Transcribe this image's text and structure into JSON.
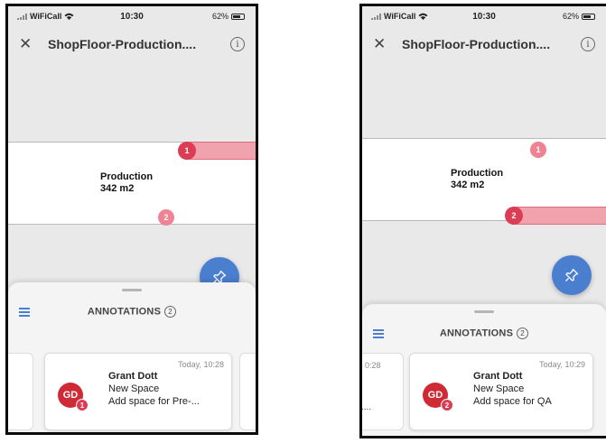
{
  "status_bar": {
    "carrier": "WiFiCall",
    "time": "10:30",
    "battery": "62%"
  },
  "header": {
    "title": "ShopFloor-Production....",
    "close_glyph": "✕",
    "info_glyph": "i"
  },
  "room": {
    "name": "Production",
    "area": "342 m2"
  },
  "annotations_panel": {
    "label": "ANNOTATIONS",
    "count": "2"
  },
  "pins": [
    "1",
    "2"
  ],
  "screens": [
    {
      "selected_annotation": "1",
      "card": {
        "timestamp": "Today, 10:28",
        "author": "Grant Dott",
        "title": "New Space",
        "note": "Add space for Pre-...",
        "avatar_initials": "GD",
        "badge": "1"
      }
    },
    {
      "selected_annotation": "2",
      "card": {
        "timestamp": "Today, 10:29",
        "author": "Grant Dott",
        "title": "New Space",
        "note": "Add space for QA",
        "avatar_initials": "GD",
        "badge": "2"
      },
      "prev_card_peek": {
        "timestamp": "0:28",
        "note": "...."
      }
    }
  ],
  "icons": {
    "close": "close-icon",
    "info": "info-icon",
    "pin": "pin-icon",
    "list": "list-icon",
    "wifi": "wifi-icon",
    "battery": "battery-icon"
  },
  "colors": {
    "accent_blue": "#4a7fd0",
    "annotation_red": "#dc3d54",
    "annotation_pink": "#f0a2ad",
    "avatar_red": "#cf2b36"
  }
}
